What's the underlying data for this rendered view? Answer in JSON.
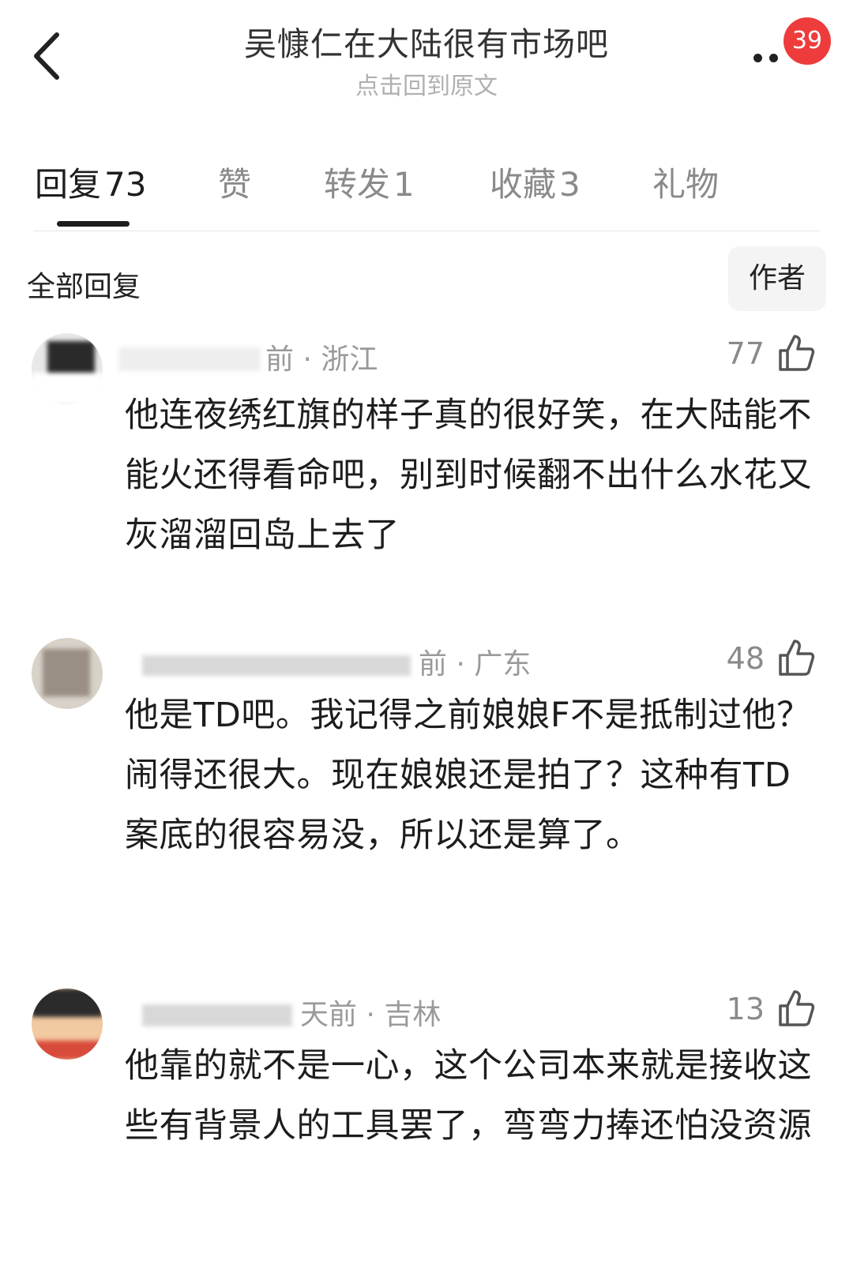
{
  "header": {
    "title": "吴慷仁在大陆很有市场吧",
    "subtitle": "点击回到原文",
    "badge_count": "39"
  },
  "tabs": [
    {
      "label": "回复",
      "count": "73"
    },
    {
      "label": "赞",
      "count": ""
    },
    {
      "label": "转发",
      "count": "1"
    },
    {
      "label": "收藏",
      "count": "3"
    },
    {
      "label": "礼物",
      "count": ""
    }
  ],
  "section": {
    "title": "全部回复",
    "author_filter": "作者"
  },
  "comments": [
    {
      "meta": "前 · 浙江",
      "likes": "77",
      "text": "他连夜绣红旗的样子真的很好笑，在大陆能不能火还得看命吧，别到时候翻不出什么水花又灰溜溜回岛上去了"
    },
    {
      "meta": "前 · 广东",
      "likes": "48",
      "text": "他是TD吧。我记得之前娘娘F不是抵制过他？闹得还很大。现在娘娘还是拍了？这种有TD案底的很容易没，所以还是算了。"
    },
    {
      "meta": "天前 · 吉林",
      "likes": "13",
      "text": "他靠的就不是一心，这个公司本来就是接收这些有背景人的工具罢了，弯弯力捧还怕没资源"
    }
  ],
  "icons": {
    "back": "chevron-left-icon",
    "more": "more-dots-icon",
    "like": "thumbs-up-icon"
  },
  "colors": {
    "badge": "#ee3c3c",
    "active_tab": "#1d1d1d",
    "inactive_tab": "#8a8a8a"
  }
}
